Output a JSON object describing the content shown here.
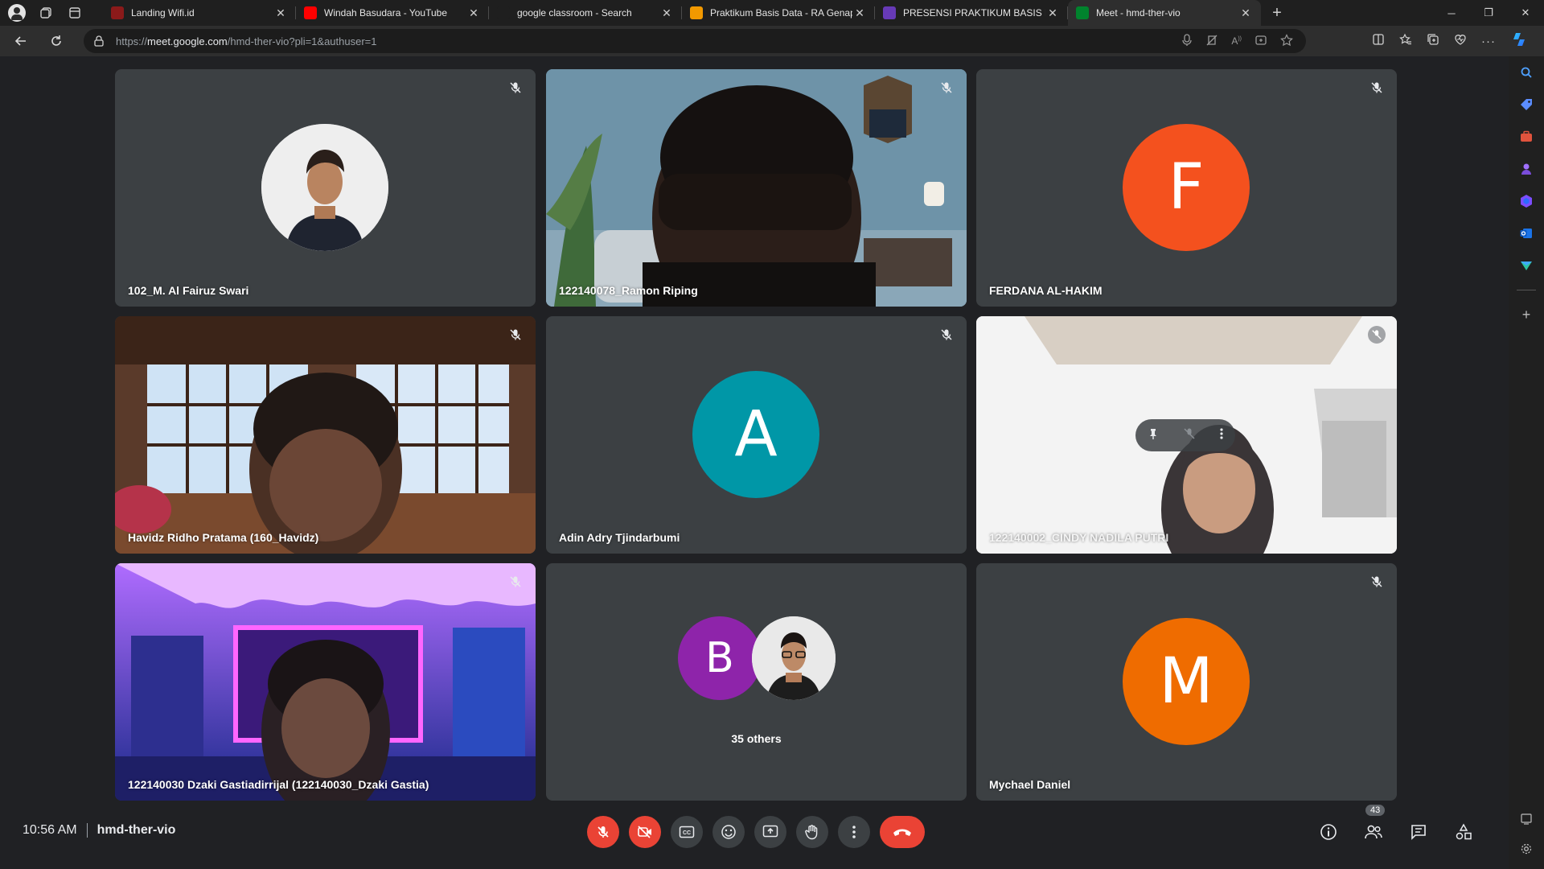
{
  "browser": {
    "tabs": [
      {
        "title": "Landing Wifi.id",
        "fav_color": "#8b1a1a",
        "fav_icon": "globe-icon",
        "active": false
      },
      {
        "title": "Windah Basudara - YouTube",
        "fav_color": "#ff0000",
        "fav_icon": "youtube-icon",
        "active": false
      },
      {
        "title": "google classroom - Search",
        "fav_color": "#1f1f1f",
        "fav_icon": "search-icon",
        "active": false
      },
      {
        "title": "Praktikum Basis Data - RA Genap",
        "fav_color": "#f29900",
        "fav_icon": "classroom-icon",
        "active": false
      },
      {
        "title": "PRESENSI PRAKTIKUM BASIS DATA",
        "fav_color": "#673ab7",
        "fav_icon": "forms-icon",
        "active": false
      },
      {
        "title": "Meet - hmd-ther-vio",
        "fav_color": "#00832d",
        "fav_icon": "meet-icon",
        "active": true
      }
    ],
    "url_prefix": "https://",
    "url_host": "meet.google.com",
    "url_path": "/hmd-ther-vio?pli=1&authuser=1"
  },
  "participants": [
    {
      "name": "102_M. Al Fairuz Swari",
      "type": "photo"
    },
    {
      "name": "122140078_Ramon Riping",
      "type": "video"
    },
    {
      "name": "FERDANA AL-HAKIM",
      "type": "letter",
      "letter": "F",
      "color": "#f4511e"
    },
    {
      "name": "Havidz Ridho Pratama (160_Havidz)",
      "type": "video"
    },
    {
      "name": "Adin Adry Tjindarbumi",
      "type": "letter",
      "letter": "A",
      "color": "#0097a7"
    },
    {
      "name": "122140002_CINDY NADILA PUTRI",
      "type": "video"
    },
    {
      "name": "122140030 Dzaki Gastiadirrijal (122140030_Dzaki Gastia)",
      "type": "video"
    },
    {
      "name": "35 others",
      "type": "others",
      "letter": "B",
      "color": "#8e24aa"
    },
    {
      "name": "Mychael Daniel",
      "type": "letter",
      "letter": "M",
      "color": "#ef6c00"
    }
  ],
  "meeting": {
    "time": "10:56 AM",
    "code": "hmd-ther-vio",
    "participant_count": "43"
  },
  "colors": {
    "stage": "#202124",
    "tile": "#3c4043",
    "danger": "#ea4335"
  }
}
